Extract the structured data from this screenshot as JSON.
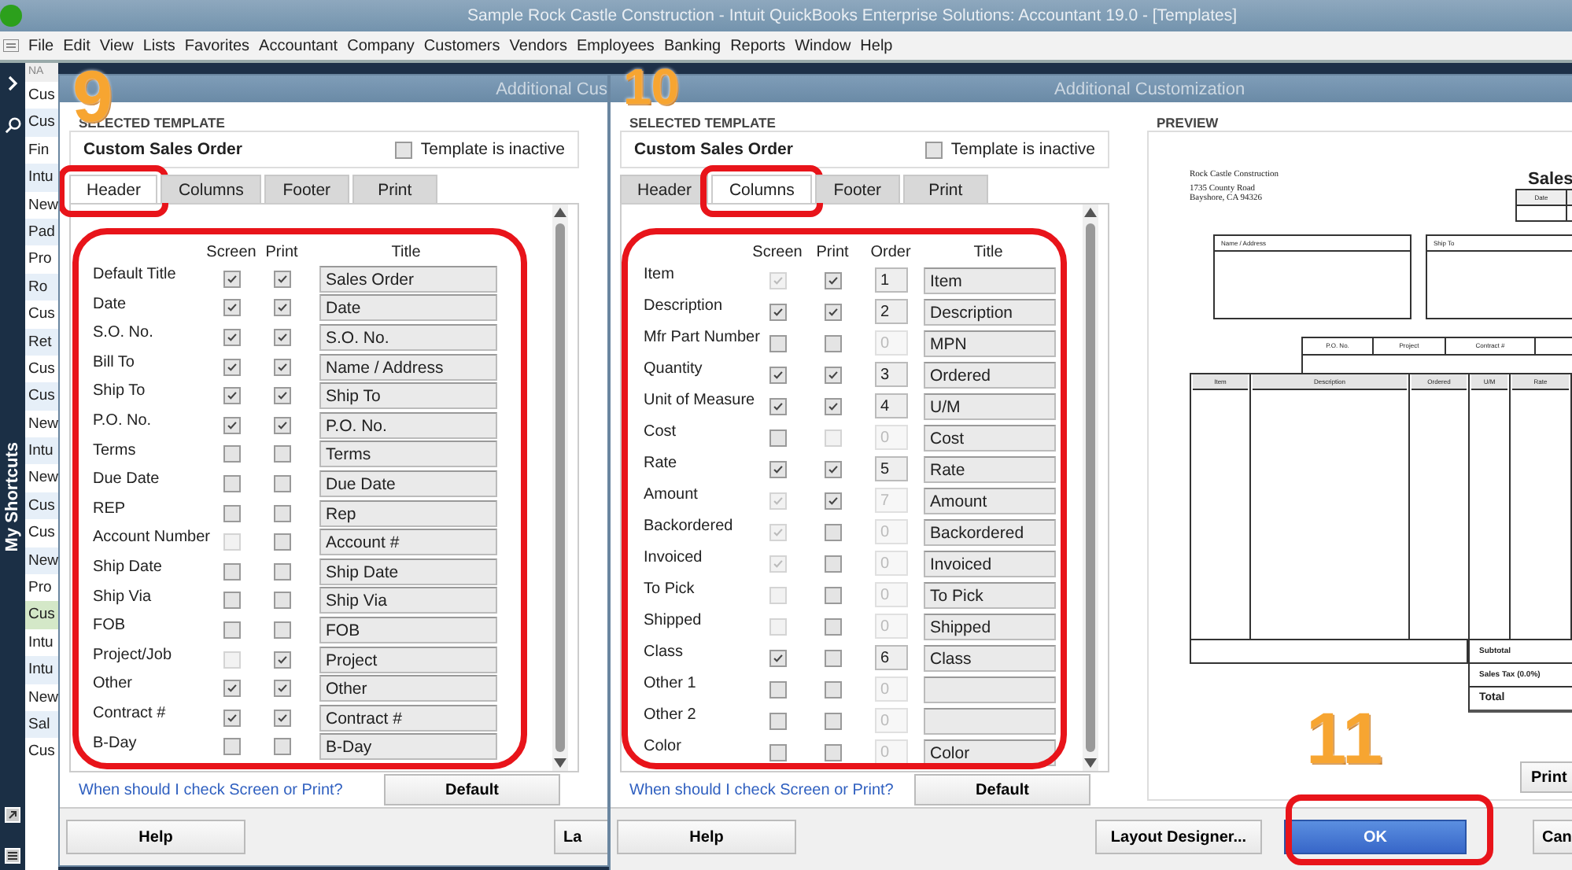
{
  "window": {
    "title": "Sample Rock Castle Construction  - Intuit QuickBooks Enterprise Solutions: Accountant 19.0 - [Templates]"
  },
  "menu": [
    "File",
    "Edit",
    "View",
    "Lists",
    "Favorites",
    "Accountant",
    "Company",
    "Customers",
    "Vendors",
    "Employees",
    "Banking",
    "Reports",
    "Window",
    "Help"
  ],
  "sidebar": {
    "label": "My Shortcuts"
  },
  "list": {
    "header": "NA",
    "items": [
      {
        "label": "Cus",
        "selected": false
      },
      {
        "label": "Cus",
        "selected": false
      },
      {
        "label": "Fin",
        "selected": false
      },
      {
        "label": "Intu",
        "selected": false
      },
      {
        "label": "New",
        "selected": false
      },
      {
        "label": "Pad",
        "selected": false
      },
      {
        "label": "Pro",
        "selected": false
      },
      {
        "label": "Ro",
        "selected": false
      },
      {
        "label": "Cus",
        "selected": false
      },
      {
        "label": "Ret",
        "selected": false
      },
      {
        "label": "Cus",
        "selected": false
      },
      {
        "label": "Cus",
        "selected": false
      },
      {
        "label": "New",
        "selected": false
      },
      {
        "label": "Intu",
        "selected": false
      },
      {
        "label": "New",
        "selected": false
      },
      {
        "label": "Cus",
        "selected": false
      },
      {
        "label": "Cus",
        "selected": false
      },
      {
        "label": "New",
        "selected": false
      },
      {
        "label": "Pro",
        "selected": false
      },
      {
        "label": "Cus",
        "selected": true
      },
      {
        "label": "Intu",
        "selected": false
      },
      {
        "label": "Intu",
        "selected": false
      },
      {
        "label": "New",
        "selected": false
      },
      {
        "label": "Sal",
        "selected": false
      },
      {
        "label": "Cus",
        "selected": false
      }
    ]
  },
  "dialogs": [
    {
      "title": "Additional Cus",
      "template_label": "SELECTED TEMPLATE",
      "template_name": "Custom Sales Order",
      "inactive": {
        "label": "Template is inactive",
        "checked": false
      },
      "tabs": [
        {
          "label": "Header",
          "selected": true
        },
        {
          "label": "Columns",
          "selected": false
        },
        {
          "label": "Footer",
          "selected": false
        },
        {
          "label": "Print",
          "selected": false
        }
      ],
      "columns": [
        "Screen",
        "Print",
        "Title"
      ],
      "rows": [
        {
          "label": "Default Title",
          "screen": {
            "checked": true,
            "disabled": false
          },
          "print": {
            "checked": true,
            "disabled": false
          },
          "title": "Sales Order"
        },
        {
          "label": "Date",
          "screen": {
            "checked": true,
            "disabled": false
          },
          "print": {
            "checked": true,
            "disabled": false
          },
          "title": "Date"
        },
        {
          "label": "S.O. No.",
          "screen": {
            "checked": true,
            "disabled": false
          },
          "print": {
            "checked": true,
            "disabled": false
          },
          "title": "S.O. No."
        },
        {
          "label": "Bill To",
          "screen": {
            "checked": true,
            "disabled": false
          },
          "print": {
            "checked": true,
            "disabled": false
          },
          "title": "Name / Address"
        },
        {
          "label": "Ship To",
          "screen": {
            "checked": true,
            "disabled": false
          },
          "print": {
            "checked": true,
            "disabled": false
          },
          "title": "Ship To"
        },
        {
          "label": "P.O. No.",
          "screen": {
            "checked": true,
            "disabled": false
          },
          "print": {
            "checked": true,
            "disabled": false
          },
          "title": "P.O. No."
        },
        {
          "label": "Terms",
          "screen": {
            "checked": false,
            "disabled": false
          },
          "print": {
            "checked": false,
            "disabled": false
          },
          "title": "Terms"
        },
        {
          "label": "Due Date",
          "screen": {
            "checked": false,
            "disabled": false
          },
          "print": {
            "checked": false,
            "disabled": false
          },
          "title": "Due Date"
        },
        {
          "label": "REP",
          "screen": {
            "checked": false,
            "disabled": false
          },
          "print": {
            "checked": false,
            "disabled": false
          },
          "title": "Rep"
        },
        {
          "label": "Account Number",
          "screen": {
            "checked": false,
            "disabled": true
          },
          "print": {
            "checked": false,
            "disabled": false
          },
          "title": "Account #"
        },
        {
          "label": "Ship Date",
          "screen": {
            "checked": false,
            "disabled": false
          },
          "print": {
            "checked": false,
            "disabled": false
          },
          "title": "Ship Date"
        },
        {
          "label": "Ship Via",
          "screen": {
            "checked": false,
            "disabled": false
          },
          "print": {
            "checked": false,
            "disabled": false
          },
          "title": "Ship Via"
        },
        {
          "label": "FOB",
          "screen": {
            "checked": false,
            "disabled": false
          },
          "print": {
            "checked": false,
            "disabled": false
          },
          "title": "FOB"
        },
        {
          "label": "Project/Job",
          "screen": {
            "checked": false,
            "disabled": true
          },
          "print": {
            "checked": true,
            "disabled": false
          },
          "title": "Project"
        },
        {
          "label": "Other",
          "screen": {
            "checked": true,
            "disabled": false
          },
          "print": {
            "checked": true,
            "disabled": false
          },
          "title": "Other"
        },
        {
          "label": "Contract #",
          "screen": {
            "checked": true,
            "disabled": false
          },
          "print": {
            "checked": true,
            "disabled": false
          },
          "title": "Contract #"
        },
        {
          "label": "B-Day",
          "screen": {
            "checked": false,
            "disabled": false
          },
          "print": {
            "checked": false,
            "disabled": false
          },
          "title": "B-Day"
        }
      ],
      "help_link": "When should I check Screen or Print?",
      "default_button": "Default",
      "buttons": [
        {
          "label": "Help",
          "kind": "normal"
        },
        {
          "label": "La",
          "kind": "cut"
        }
      ]
    },
    {
      "title": "Additional Customization",
      "template_label": "SELECTED TEMPLATE",
      "template_name": "Custom Sales Order",
      "inactive": {
        "label": "Template is inactive",
        "checked": false
      },
      "tabs": [
        {
          "label": "Header",
          "selected": false
        },
        {
          "label": "Columns",
          "selected": true
        },
        {
          "label": "Footer",
          "selected": false
        },
        {
          "label": "Print",
          "selected": false
        }
      ],
      "columns": [
        "Screen",
        "Print",
        "Order",
        "Title"
      ],
      "rows": [
        {
          "label": "Item",
          "screen": {
            "checked": true,
            "disabled": true
          },
          "print": {
            "checked": true,
            "disabled": false
          },
          "order": {
            "value": "1",
            "disabled": false
          },
          "title": "Item"
        },
        {
          "label": "Description",
          "screen": {
            "checked": true,
            "disabled": false
          },
          "print": {
            "checked": true,
            "disabled": false
          },
          "order": {
            "value": "2",
            "disabled": false
          },
          "title": "Description"
        },
        {
          "label": "Mfr Part Number",
          "screen": {
            "checked": false,
            "disabled": false
          },
          "print": {
            "checked": false,
            "disabled": false
          },
          "order": {
            "value": "0",
            "disabled": true
          },
          "title": "MPN"
        },
        {
          "label": "Quantity",
          "screen": {
            "checked": true,
            "disabled": false
          },
          "print": {
            "checked": true,
            "disabled": false
          },
          "order": {
            "value": "3",
            "disabled": false
          },
          "title": "Ordered"
        },
        {
          "label": "Unit of Measure",
          "screen": {
            "checked": true,
            "disabled": false
          },
          "print": {
            "checked": true,
            "disabled": false
          },
          "order": {
            "value": "4",
            "disabled": false
          },
          "title": "U/M"
        },
        {
          "label": "Cost",
          "screen": {
            "checked": false,
            "disabled": false
          },
          "print": {
            "checked": false,
            "disabled": true
          },
          "order": {
            "value": "0",
            "disabled": true
          },
          "title": "Cost"
        },
        {
          "label": "Rate",
          "screen": {
            "checked": true,
            "disabled": false
          },
          "print": {
            "checked": true,
            "disabled": false
          },
          "order": {
            "value": "5",
            "disabled": false
          },
          "title": "Rate"
        },
        {
          "label": "Amount",
          "screen": {
            "checked": true,
            "disabled": true
          },
          "print": {
            "checked": true,
            "disabled": false
          },
          "order": {
            "value": "7",
            "disabled": true
          },
          "title": "Amount"
        },
        {
          "label": "Backordered",
          "screen": {
            "checked": true,
            "disabled": true
          },
          "print": {
            "checked": false,
            "disabled": false
          },
          "order": {
            "value": "0",
            "disabled": true
          },
          "title": "Backordered"
        },
        {
          "label": "Invoiced",
          "screen": {
            "checked": true,
            "disabled": true
          },
          "print": {
            "checked": false,
            "disabled": false
          },
          "order": {
            "value": "0",
            "disabled": true
          },
          "title": "Invoiced"
        },
        {
          "label": "To Pick",
          "screen": {
            "checked": false,
            "disabled": true
          },
          "print": {
            "checked": false,
            "disabled": false
          },
          "order": {
            "value": "0",
            "disabled": true
          },
          "title": "To Pick"
        },
        {
          "label": "Shipped",
          "screen": {
            "checked": false,
            "disabled": true
          },
          "print": {
            "checked": false,
            "disabled": false
          },
          "order": {
            "value": "0",
            "disabled": true
          },
          "title": "Shipped"
        },
        {
          "label": "Class",
          "screen": {
            "checked": true,
            "disabled": false
          },
          "print": {
            "checked": false,
            "disabled": false
          },
          "order": {
            "value": "6",
            "disabled": false
          },
          "title": "Class"
        },
        {
          "label": "Other 1",
          "screen": {
            "checked": false,
            "disabled": false
          },
          "print": {
            "checked": false,
            "disabled": false
          },
          "order": {
            "value": "0",
            "disabled": true
          }
        },
        {
          "label": "Other 2",
          "screen": {
            "checked": false,
            "disabled": false
          },
          "print": {
            "checked": false,
            "disabled": false
          },
          "order": {
            "value": "0",
            "disabled": true
          }
        },
        {
          "label": "Color",
          "screen": {
            "checked": false,
            "disabled": false
          },
          "print": {
            "checked": false,
            "disabled": false
          },
          "order": {
            "value": "0",
            "disabled": true
          },
          "title": "Color"
        }
      ],
      "help_link": "When should I check Screen or Print?",
      "default_button": "Default",
      "preview": {
        "label": "PREVIEW",
        "company": [
          "Rock Castle Construction",
          "1735 County Road",
          "Bayshore, CA 94326"
        ],
        "doc_title": "Sales",
        "date_header": "Date",
        "bill_header": "Name / Address",
        "ship_header": "Ship To",
        "info_headers": [
          "P.O. No.",
          "Project",
          "Contract #"
        ],
        "item_headers": [
          "Item",
          "Description",
          "Ordered",
          "U/M",
          "Rate"
        ],
        "totals": [
          "Subtotal",
          "Sales Tax (0.0%)",
          "Total"
        ],
        "print_button": "Print"
      },
      "buttons": [
        {
          "label": "Help",
          "kind": "normal"
        },
        {
          "label": "Layout Designer...",
          "kind": "normal"
        },
        {
          "label": "OK",
          "kind": "primary"
        },
        {
          "label": "Can",
          "kind": "cut"
        }
      ]
    }
  ],
  "annotations": [
    {
      "label": "9"
    },
    {
      "label": "10"
    },
    {
      "label": "11"
    }
  ]
}
